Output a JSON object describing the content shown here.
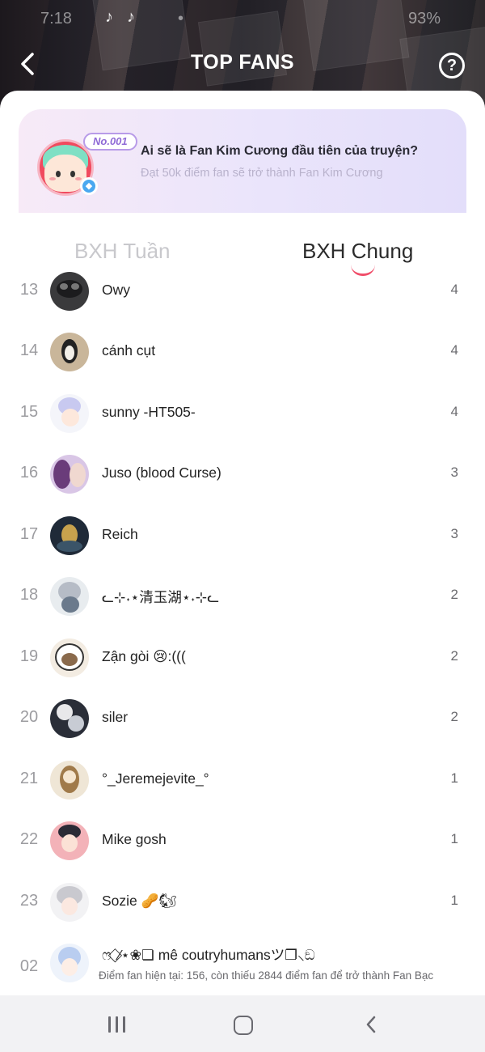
{
  "statusbar": {
    "time": "7:18",
    "dot": "•",
    "battery": "93%",
    "tiktok_glyph": "♪"
  },
  "header": {
    "title": "TOP FANS",
    "help_glyph": "?"
  },
  "banner": {
    "badge": "No.001",
    "title": "Ai sẽ là Fan Kim Cương đầu tiên của truyện?",
    "subtitle": "Đạt 50k điểm fan sẽ trở thành Fan Kim Cương"
  },
  "tabs": {
    "weekly": "BXH Tuần",
    "overall": "BXH Chung",
    "active": "overall"
  },
  "rows": [
    {
      "rank": "13",
      "name": "Owy",
      "score": "4"
    },
    {
      "rank": "14",
      "name": "cánh cụt",
      "score": "4"
    },
    {
      "rank": "15",
      "name": "sunny -HT505-",
      "score": "4"
    },
    {
      "rank": "16",
      "name": "Juso (blood Curse)",
      "score": "3"
    },
    {
      "rank": "17",
      "name": "Reich",
      "score": "3"
    },
    {
      "rank": "18",
      "name": "ᓚ⊹˖⋆清玉湖⋆˖⊹ᓚ",
      "score": "2"
    },
    {
      "rank": "19",
      "name": "Zận gòi 😢:(((",
      "score": "2"
    },
    {
      "rank": "20",
      "name": "siler",
      "score": "2"
    },
    {
      "rank": "21",
      "name": "°_Jeremejevite_°",
      "score": "1"
    },
    {
      "rank": "22",
      "name": "Mike gosh",
      "score": "1"
    },
    {
      "rank": "23",
      "name": "Sozie 🥜🐿",
      "score": "1"
    }
  ],
  "self": {
    "rank": "02",
    "name": "ෆ ⃟⁄⋆❀❏ mê coutryhumansツ❐⸜ඞ",
    "hint": "Điểm fan hiện tại: 156, còn thiếu 2844 điểm fan để trở thành Fan Bạc"
  }
}
